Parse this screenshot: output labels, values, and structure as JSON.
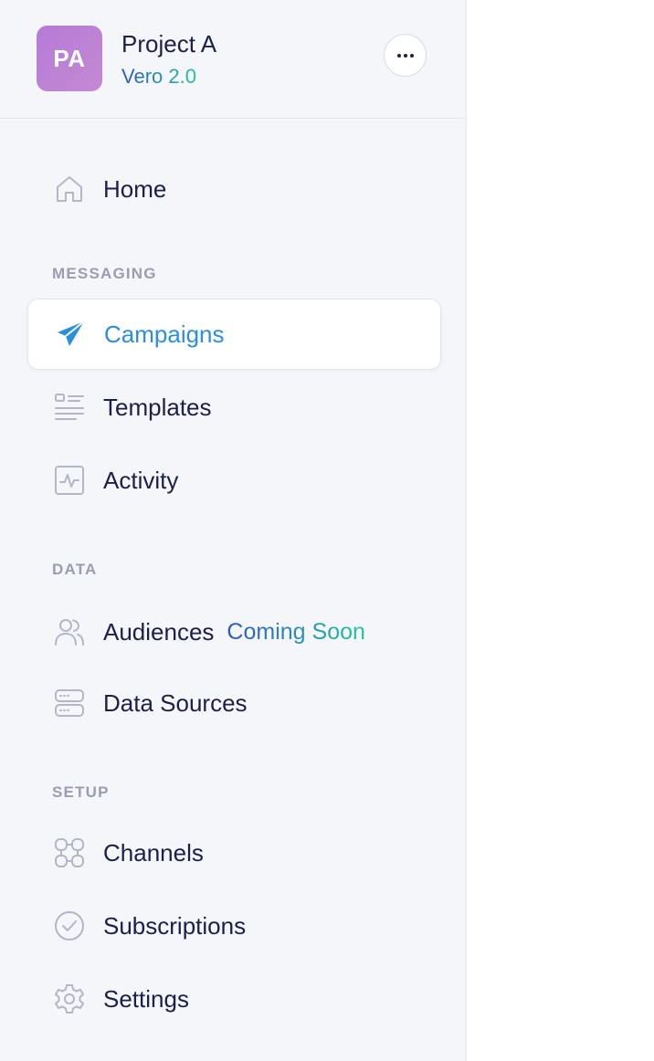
{
  "project": {
    "initials": "PA",
    "name": "Project A",
    "version": "Vero 2.0",
    "avatar_color": "#b57bd6"
  },
  "more_button": {
    "icon": "more-horizontal-icon"
  },
  "nav": {
    "home": {
      "label": "Home",
      "icon": "home-icon"
    },
    "sections": {
      "messaging": "MESSAGING",
      "data": "DATA",
      "setup": "SETUP"
    },
    "campaigns": {
      "label": "Campaigns",
      "icon": "paper-plane-icon",
      "active": true
    },
    "templates": {
      "label": "Templates",
      "icon": "templates-list-icon"
    },
    "activity": {
      "label": "Activity",
      "icon": "activity-pulse-icon"
    },
    "audiences": {
      "label": "Audiences",
      "icon": "users-icon",
      "badge": "Coming Soon"
    },
    "data_sources": {
      "label": "Data Sources",
      "icon": "server-icon"
    },
    "channels": {
      "label": "Channels",
      "icon": "channels-grid-icon"
    },
    "subscriptions": {
      "label": "Subscriptions",
      "icon": "check-circle-icon"
    },
    "settings": {
      "label": "Settings",
      "icon": "gear-icon"
    }
  },
  "colors": {
    "active_accent": "#2a8fe0",
    "text": "#1c1f4a",
    "muted": "#9a9db2",
    "gradient_start": "#2f56c9",
    "gradient_end": "#22c79c",
    "sidebar_bg": "#f5f6fa"
  }
}
